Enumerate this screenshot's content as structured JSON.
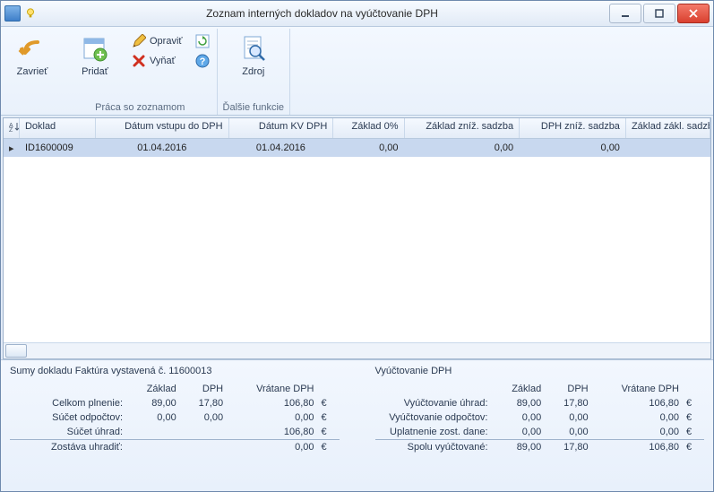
{
  "window": {
    "title": "Zoznam interných dokladov na vyúčtovanie DPH"
  },
  "ribbon": {
    "close": "Zavrieť",
    "add": "Pridať",
    "edit": "Opraviť",
    "remove": "Vyňať",
    "source": "Zdroj",
    "group_list": "Práca so zoznamom",
    "group_more": "Ďalšie funkcie"
  },
  "grid": {
    "headers": {
      "doc": "Doklad",
      "date_in_dph": "Dátum vstupu do DPH",
      "date_kv_dph": "Dátum KV DPH",
      "base0": "Základ 0%",
      "base_low": "Základ zníž. sadzba",
      "vat_low": "DPH zníž. sadzba",
      "base_std": "Základ zákl. sadzba"
    },
    "rows": [
      {
        "doc": "ID1600009",
        "date_in_dph": "01.04.2016",
        "date_kv_dph": "01.04.2016",
        "base0": "0,00",
        "base_low": "0,00",
        "vat_low": "0,00",
        "base_std": ""
      }
    ]
  },
  "summary_left": {
    "title": "Sumy dokladu Faktúra vystavená č. 11600013",
    "head_base": "Základ",
    "head_vat": "DPH",
    "head_gross": "Vrátane DPH",
    "rows": {
      "total_label": "Celkom plnenie:",
      "total_base": "89,00",
      "total_vat": "17,80",
      "total_gross": "106,80",
      "ded_label": "Súčet odpočtov:",
      "ded_base": "0,00",
      "ded_vat": "0,00",
      "ded_gross": "0,00",
      "paid_label": "Súčet úhrad:",
      "paid_gross": "106,80",
      "remain_label": "Zostáva uhradiť:",
      "remain_gross": "0,00"
    },
    "currency": "€"
  },
  "summary_right": {
    "title": "Vyúčtovanie DPH",
    "head_base": "Základ",
    "head_vat": "DPH",
    "head_gross": "Vrátane DPH",
    "rows": {
      "pay_label": "Vyúčtovanie úhrad:",
      "pay_base": "89,00",
      "pay_vat": "17,80",
      "pay_gross": "106,80",
      "ded_label": "Vyúčtovanie odpočtov:",
      "ded_base": "0,00",
      "ded_vat": "0,00",
      "ded_gross": "0,00",
      "rest_label": "Uplatnenie zost. dane:",
      "rest_base": "0,00",
      "rest_vat": "0,00",
      "rest_gross": "0,00",
      "sum_label": "Spolu vyúčtované:",
      "sum_base": "89,00",
      "sum_vat": "17,80",
      "sum_gross": "106,80"
    },
    "currency": "€"
  }
}
